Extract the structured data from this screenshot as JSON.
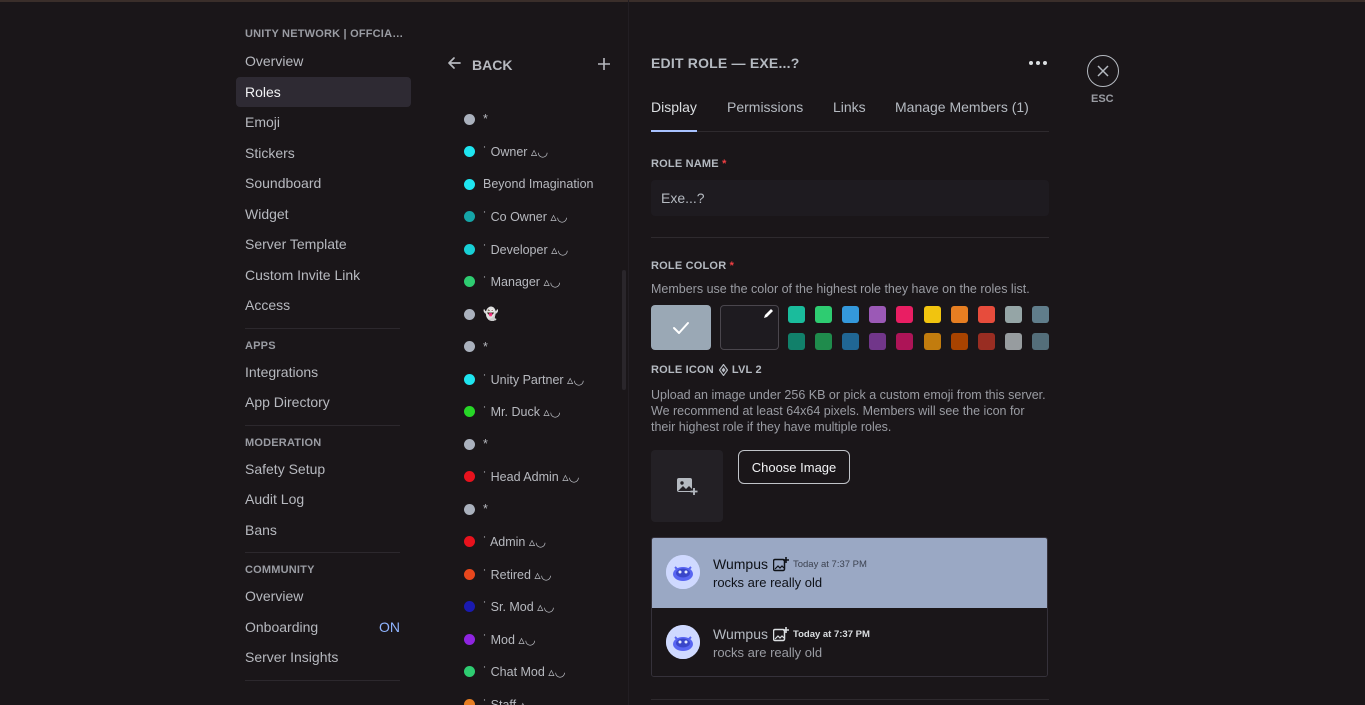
{
  "sidebar": {
    "server_title": "UNITY NETWORK | OFFCIAL...",
    "server_items": [
      "Overview",
      "Roles",
      "Emoji",
      "Stickers",
      "Soundboard",
      "Widget",
      "Server Template",
      "Custom Invite Link",
      "Access"
    ],
    "apps_title": "APPS",
    "apps_items": [
      "Integrations",
      "App Directory"
    ],
    "moderation_title": "MODERATION",
    "moderation_items": [
      "Safety Setup",
      "Audit Log",
      "Bans"
    ],
    "community_title": "COMMUNITY",
    "community_items": [
      "Overview",
      "Onboarding",
      "Server Insights"
    ],
    "onboarding_badge": "ON"
  },
  "roles_column": {
    "back_label": "BACK",
    "add_icon": "plus-icon",
    "roles": [
      {
        "name": "*",
        "color": "#aab1bd"
      },
      {
        "name": "˙͏͏͏͏͏͏͏͏ Owner ▵◡",
        "color": "#1fe5f0"
      },
      {
        "name": "Beyond Imagination",
        "color": "#1fe5f0"
      },
      {
        "name": "˙͏͏͏͏͏͏͏͏ Co Owner ▵◡",
        "color": "#15a5a7"
      },
      {
        "name": "˙͏͏͏͏͏͏͏͏ Developer ▵◡",
        "color": "#18d0d6"
      },
      {
        "name": "˙͏͏͏͏͏͏͏͏ Manager ▵◡",
        "color": "#2ecc71"
      },
      {
        "name": "👻",
        "color": "#aab1bd"
      },
      {
        "name": "*",
        "color": "#aab1bd"
      },
      {
        "name": "˙͏͏͏͏͏͏͏͏ Unity Partner ▵◡",
        "color": "#1fe5f0"
      },
      {
        "name": "˙͏͏͏͏͏͏͏͏ Mr. Duck ▵◡",
        "color": "#27d627"
      },
      {
        "name": "*",
        "color": "#aab1bd"
      },
      {
        "name": "˙͏͏͏͏͏͏͏͏ Head Admin ▵◡",
        "color": "#e8121d"
      },
      {
        "name": "*",
        "color": "#aab1bd"
      },
      {
        "name": "˙͏͏͏͏͏͏͏͏ Admin ▵◡",
        "color": "#e8121d"
      },
      {
        "name": "˙͏͏͏͏͏͏͏͏ Retired ▵◡",
        "color": "#e8471d"
      },
      {
        "name": "˙͏͏͏͏͏͏͏͏ Sr. Mod ▵◡",
        "color": "#1a1ab0"
      },
      {
        "name": "˙͏͏͏͏͏͏͏͏ Mod ▵◡",
        "color": "#8e24e0"
      },
      {
        "name": "˙͏͏͏͏͏͏͏͏ Chat Mod ▵◡",
        "color": "#2ecc71"
      },
      {
        "name": "˙͏͏͏͏͏͏͏͏ Staff ▵◡",
        "color": "#e67e22"
      }
    ]
  },
  "editor": {
    "title": "EDIT ROLE — EXE...?",
    "more_icon": "more-dots-icon",
    "tabs": [
      "Display",
      "Permissions",
      "Links",
      "Manage Members (1)"
    ],
    "active_tab": "Display",
    "role_name_label": "ROLE NAME",
    "required_mark": "*",
    "role_name_value": "Exe...?",
    "role_color_label": "ROLE COLOR",
    "role_color_help": "Members use the color of the highest role they have on the roles list.",
    "selected_color": "#9aa8b5",
    "swatches_row1": [
      "#1abc9c",
      "#2ecc71",
      "#3498db",
      "#9b59b6",
      "#e91e63",
      "#f1c40f",
      "#e67e22",
      "#e74c3c",
      "#95a5a6",
      "#607d8b"
    ],
    "swatches_row2": [
      "#11806a",
      "#1f8b4c",
      "#206694",
      "#71368a",
      "#ad1457",
      "#c27c0e",
      "#a84300",
      "#992d22",
      "#979c9f",
      "#546e7a"
    ],
    "role_icon_label": "ROLE ICON",
    "role_icon_level": "LVL 2",
    "role_icon_help": "Upload an image under 256 KB or pick a custom emoji from this server. We recommend at least 64x64 pixels. Members will see the icon for their highest role if they have multiple roles.",
    "choose_image_label": "Choose Image",
    "preview": {
      "username": "Wumpus",
      "timestamp": "Today at 7:37 PM",
      "message": "rocks are really old"
    }
  },
  "close": {
    "icon": "close-icon",
    "label": "ESC"
  }
}
